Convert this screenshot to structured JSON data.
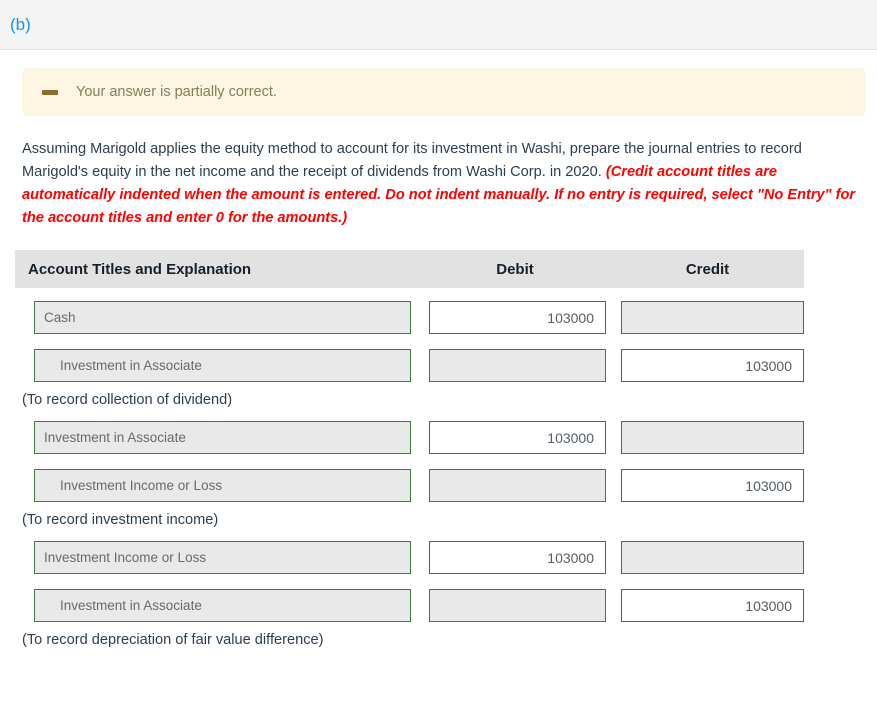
{
  "part": {
    "label": "(b)"
  },
  "alert": {
    "icon": "minus-dash-icon",
    "text": "Your answer is partially correct."
  },
  "instructions": {
    "normal_text": "Assuming Marigold applies the equity method to account for its investment in Washi, prepare the journal entries to record Marigold's equity in the net income and the receipt of dividends from Washi Corp. in 2020. ",
    "emphasis_text": "(Credit account titles are automatically indented when the amount is entered. Do not indent manually. If no entry is required, select \"No Entry\" for the account titles and enter 0 for the amounts.)"
  },
  "table": {
    "headers": {
      "account": "Account Titles and Explanation",
      "debit": "Debit",
      "credit": "Credit"
    },
    "entries": [
      {
        "rows": [
          {
            "account": "Cash",
            "indented": false,
            "debit": "103000",
            "credit": ""
          },
          {
            "account": "Investment in Associate",
            "indented": true,
            "debit": "",
            "credit": "103000"
          }
        ],
        "caption": "(To record collection of dividend)"
      },
      {
        "rows": [
          {
            "account": "Investment in Associate",
            "indented": false,
            "debit": "103000",
            "credit": ""
          },
          {
            "account": "Investment Income or Loss",
            "indented": true,
            "debit": "",
            "credit": "103000"
          }
        ],
        "caption": "(To record investment income)"
      },
      {
        "rows": [
          {
            "account": "Investment Income or Loss",
            "indented": false,
            "debit": "103000",
            "credit": ""
          },
          {
            "account": "Investment in Associate",
            "indented": true,
            "debit": "",
            "credit": "103000"
          }
        ],
        "caption": "(To record depreciation of fair value difference)"
      }
    ]
  },
  "colors": {
    "valid_border": "#3e7b3e",
    "invalid_border": "#b03a3a",
    "alert_bg": "#fdf6e3",
    "alert_text": "#8a7a5c",
    "emphasis": "#ff0000",
    "part_label": "#1a90f0"
  }
}
